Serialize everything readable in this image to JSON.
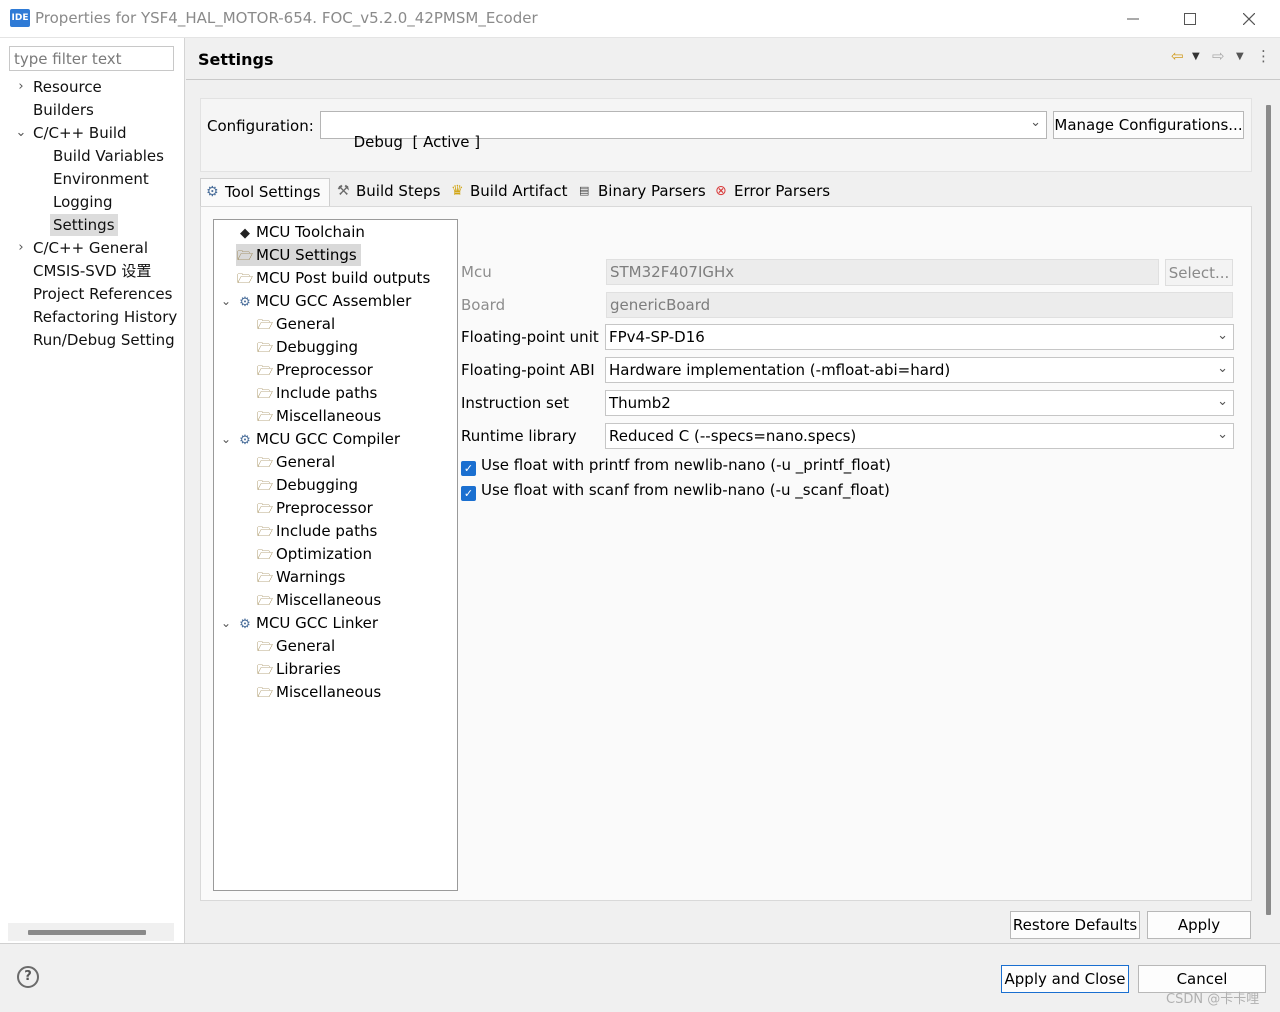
{
  "window": {
    "app_icon": "IDE",
    "title": "Properties for YSF4_HAL_MOTOR-654. FOC_v5.2.0_42PMSM_Ecoder",
    "minimize_icon": "minimize-icon",
    "maximize_icon": "maximize-icon",
    "close_icon": "close-icon"
  },
  "sidebar": {
    "filter_placeholder": "type filter text",
    "items": [
      {
        "label": "Resource",
        "chevron": "›"
      },
      {
        "label": "Builders",
        "chevron": ""
      },
      {
        "label": "C/C++ Build",
        "chevron": "⌄"
      },
      {
        "label": "Build Variables",
        "chevron": ""
      },
      {
        "label": "Environment",
        "chevron": ""
      },
      {
        "label": "Logging",
        "chevron": ""
      },
      {
        "label": "Settings",
        "chevron": "",
        "selected": true
      },
      {
        "label": "C/C++ General",
        "chevron": "›"
      },
      {
        "label": "CMSIS-SVD 设置",
        "chevron": ""
      },
      {
        "label": "Project References",
        "chevron": ""
      },
      {
        "label": "Refactoring History",
        "chevron": ""
      },
      {
        "label": "Run/Debug Setting",
        "chevron": ""
      }
    ]
  },
  "header": {
    "title": "Settings",
    "back_icon": "⇦",
    "forward_icon": "⇨",
    "menu_icon": "⋮"
  },
  "config": {
    "label": "Configuration:",
    "value": "Debug  [ Active ]",
    "manage_button": "Manage Configurations..."
  },
  "tabs": [
    {
      "label": "Tool Settings",
      "icon": "gear-icon",
      "active": true
    },
    {
      "label": "Build Steps",
      "icon": "hammer-icon"
    },
    {
      "label": "Build Artifact",
      "icon": "trophy-icon"
    },
    {
      "label": "Binary Parsers",
      "icon": "binary-icon"
    },
    {
      "label": "Error Parsers",
      "icon": "error-icon"
    }
  ],
  "tool_tree": {
    "items": [
      {
        "label": "MCU Toolchain",
        "icon": "chip-icon",
        "chevron": ""
      },
      {
        "label": "MCU Settings",
        "icon": "settings-folder-icon",
        "chevron": "",
        "selected": true
      },
      {
        "label": "MCU Post build outputs",
        "icon": "settings-folder-icon",
        "chevron": ""
      },
      {
        "label": "MCU GCC Assembler",
        "icon": "tool-icon",
        "chevron": "⌄"
      },
      {
        "label": "General",
        "icon": "settings-folder-icon",
        "chevron": ""
      },
      {
        "label": "Debugging",
        "icon": "settings-folder-icon",
        "chevron": ""
      },
      {
        "label": "Preprocessor",
        "icon": "settings-folder-icon",
        "chevron": ""
      },
      {
        "label": "Include paths",
        "icon": "settings-folder-icon",
        "chevron": ""
      },
      {
        "label": "Miscellaneous",
        "icon": "settings-folder-icon",
        "chevron": ""
      },
      {
        "label": "MCU GCC Compiler",
        "icon": "tool-icon",
        "chevron": "⌄"
      },
      {
        "label": "General",
        "icon": "settings-folder-icon",
        "chevron": ""
      },
      {
        "label": "Debugging",
        "icon": "settings-folder-icon",
        "chevron": ""
      },
      {
        "label": "Preprocessor",
        "icon": "settings-folder-icon",
        "chevron": ""
      },
      {
        "label": "Include paths",
        "icon": "settings-folder-icon",
        "chevron": ""
      },
      {
        "label": "Optimization",
        "icon": "settings-folder-icon",
        "chevron": ""
      },
      {
        "label": "Warnings",
        "icon": "settings-folder-icon",
        "chevron": ""
      },
      {
        "label": "Miscellaneous",
        "icon": "settings-folder-icon",
        "chevron": ""
      },
      {
        "label": "MCU GCC Linker",
        "icon": "tool-icon",
        "chevron": "⌄"
      },
      {
        "label": "General",
        "icon": "settings-folder-icon",
        "chevron": ""
      },
      {
        "label": "Libraries",
        "icon": "settings-folder-icon",
        "chevron": ""
      },
      {
        "label": "Miscellaneous",
        "icon": "settings-folder-icon",
        "chevron": ""
      }
    ]
  },
  "mcu_settings": {
    "mcu_label": "Mcu",
    "mcu_value": "STM32F407IGHx",
    "select_button": "Select...",
    "board_label": "Board",
    "board_value": "genericBoard",
    "fpu_label": "Floating-point unit",
    "fpu_value": "FPv4-SP-D16",
    "abi_label": "Floating-point ABI",
    "abi_value": "Hardware implementation (-mfloat-abi=hard)",
    "iset_label": "Instruction set",
    "iset_value": "Thumb2",
    "runtime_label": "Runtime library",
    "runtime_value": "Reduced C (--specs=nano.specs)",
    "printf_float_label": "Use float with printf from newlib-nano (-u _printf_float)",
    "scanf_float_label": "Use float with scanf from newlib-nano (-u _scanf_float)"
  },
  "footer": {
    "restore_defaults": "Restore Defaults",
    "apply": "Apply",
    "apply_close": "Apply and Close",
    "cancel": "Cancel",
    "help_glyph": "?",
    "watermark": "CSDN @卡卡哩"
  },
  "colors": {
    "accent": "#1a6fd0",
    "selection": "#d9d9d9",
    "background": "#f0f0f0"
  }
}
